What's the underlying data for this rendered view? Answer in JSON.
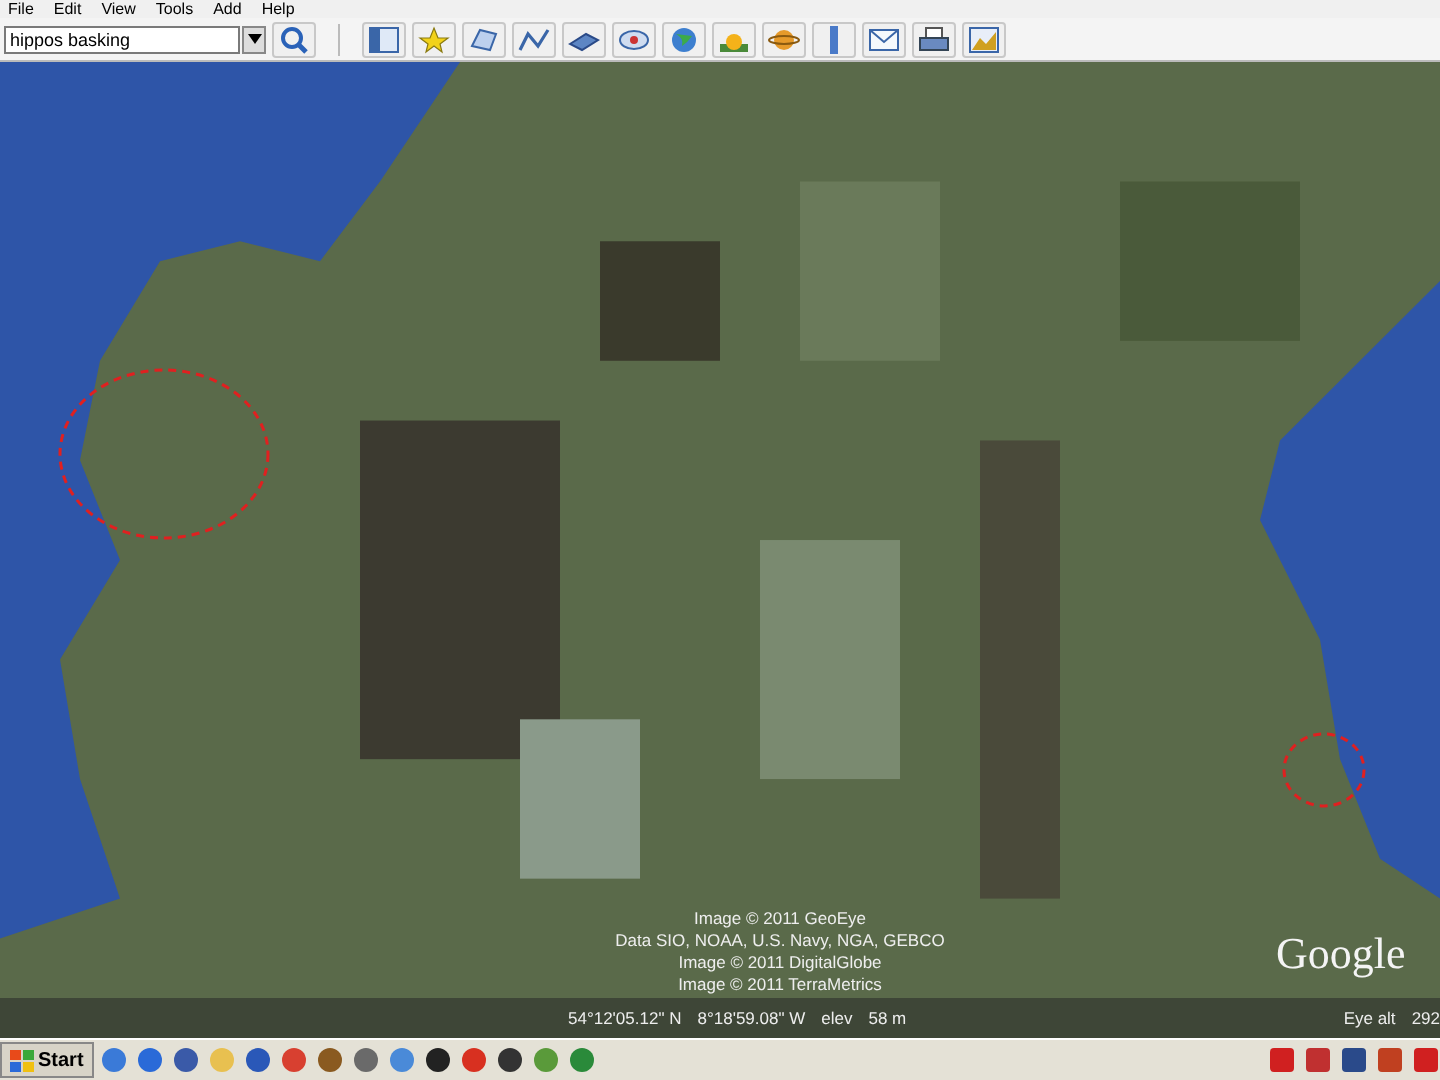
{
  "menu": [
    "File",
    "Edit",
    "View",
    "Tools",
    "Add",
    "Help"
  ],
  "search": {
    "value": "hippos basking"
  },
  "attribution": [
    "Image © 2011 GeoEye",
    "Data SIO, NOAA, U.S. Navy, NGA, GEBCO",
    "Image © 2011 DigitalGlobe",
    "Image © 2011 TerraMetrics"
  ],
  "logo": "Google",
  "status_bar": {
    "latitude": "54°12'05.12\" N",
    "longitude": "8°18'59.08\" W",
    "elev_label": "elev",
    "elev_value": "58 m",
    "eye_alt_label": "Eye alt",
    "eye_alt_value": "292"
  },
  "taskbar": {
    "start": "Start"
  }
}
